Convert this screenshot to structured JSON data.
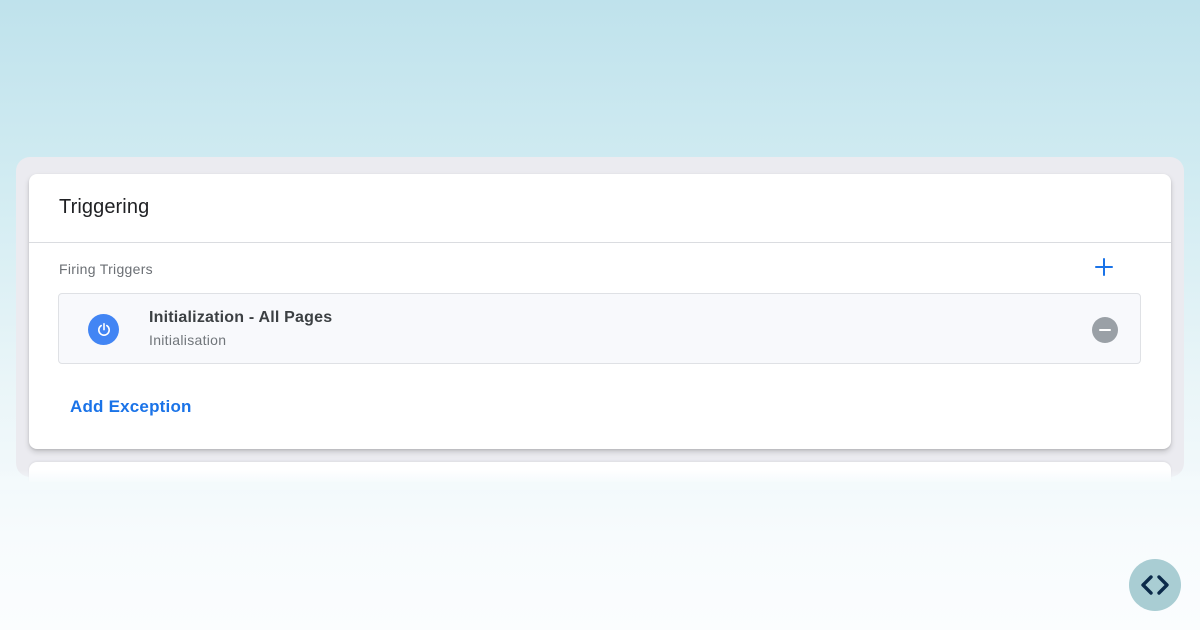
{
  "card": {
    "title": "Triggering"
  },
  "firing_triggers": {
    "section_label": "Firing Triggers",
    "add_icon": "plus-icon",
    "items": [
      {
        "name": "Initialization - All Pages",
        "type": "Initialisation",
        "icon": "power-icon",
        "icon_color": "#4285f4",
        "remove_icon": "minus-circle-icon"
      }
    ]
  },
  "exceptions": {
    "add_label": "Add Exception"
  },
  "floating_button": {
    "icon": "code-brackets-icon"
  },
  "colors": {
    "accent": "#1a73e8",
    "trigger_icon_bg": "#4285f4",
    "remove_button": "#9aa0a6",
    "background_top": "#bfe2ec"
  }
}
